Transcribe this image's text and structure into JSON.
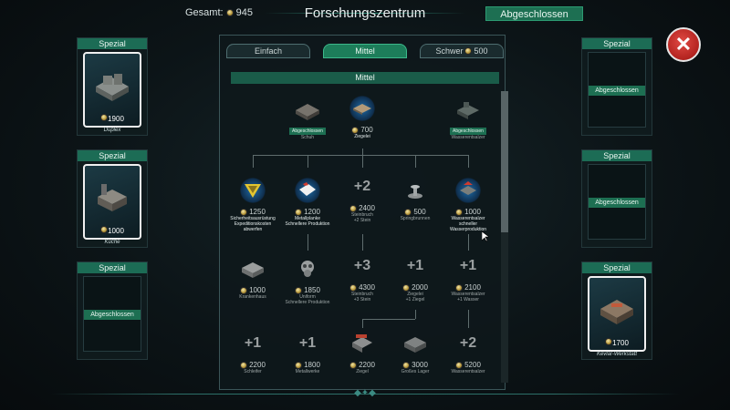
{
  "header": {
    "total_label": "Gesamt:",
    "total_value": "945",
    "title": "Forschungszentrum",
    "status": "Abgeschlossen"
  },
  "left_slots": [
    {
      "head": "Spezial",
      "price": "1900",
      "label": "Duplex"
    },
    {
      "head": "Spezial",
      "price": "1000",
      "label": "Küche"
    },
    {
      "head": "Spezial",
      "status": "Abgeschlossen"
    }
  ],
  "right_slots": [
    {
      "head": "Spezial",
      "status": "Abgeschlossen"
    },
    {
      "head": "Spezial",
      "status": "Abgeschlossen"
    },
    {
      "head": "Spezial",
      "price": "1700",
      "label": "Kevlar-Werkstatt"
    }
  ],
  "tabs": [
    {
      "label": "Einfach"
    },
    {
      "label": "Mittel"
    },
    {
      "label": "Schwer",
      "price": "500"
    }
  ],
  "section_title": "Mittel",
  "tree": {
    "row1": [
      {
        "status": "Abgeschlossen",
        "name": "Schuh"
      },
      {
        "price": "700",
        "name": "Ziegelei"
      },
      {
        "status": "Abgeschlossen",
        "name": "Wasserentsalzer"
      }
    ],
    "row2": [
      {
        "price": "1250",
        "name": "Sicherheitsausrüstung",
        "sub": "Expeditionskosten abwerfen"
      },
      {
        "price": "1200",
        "name": "Metallplanke",
        "sub": "Schnellere Produktion"
      },
      {
        "badge": "+2",
        "price": "2400",
        "name": "Steinbruch",
        "sub": "+2 Stein"
      },
      {
        "price": "500",
        "name": "Springbrunnen"
      },
      {
        "price": "1000",
        "name": "Wasserentsalzer",
        "sub": "schneller Wasserproduktion"
      }
    ],
    "row3": [
      {
        "price": "1000",
        "name": "Krankenhaus"
      },
      {
        "price": "1850",
        "name": "Uniform",
        "sub": "Schnellere Produktion"
      },
      {
        "badge": "+3",
        "price": "4300",
        "name": "Steinbruch",
        "sub": "+3 Stein"
      },
      {
        "badge": "+1",
        "price": "2000",
        "name": "Ziegelei",
        "sub": "+1 Ziegel"
      },
      {
        "badge": "+1",
        "price": "2100",
        "name": "Wasserentsalzer",
        "sub": "+1 Wasser"
      }
    ],
    "row4": [
      {
        "badge": "+1",
        "price": "2200",
        "name": "Schleifer"
      },
      {
        "badge": "+1",
        "price": "1800",
        "name": "Metallwerke"
      },
      {
        "price": "2200",
        "name": "Ziegel"
      },
      {
        "price": "3000",
        "name": "Großes Lager"
      },
      {
        "badge": "+2",
        "price": "5200",
        "name": "Wasserentsalzer"
      }
    ]
  },
  "icons": {
    "close": "close-x-icon",
    "currency": "coin-icon"
  }
}
